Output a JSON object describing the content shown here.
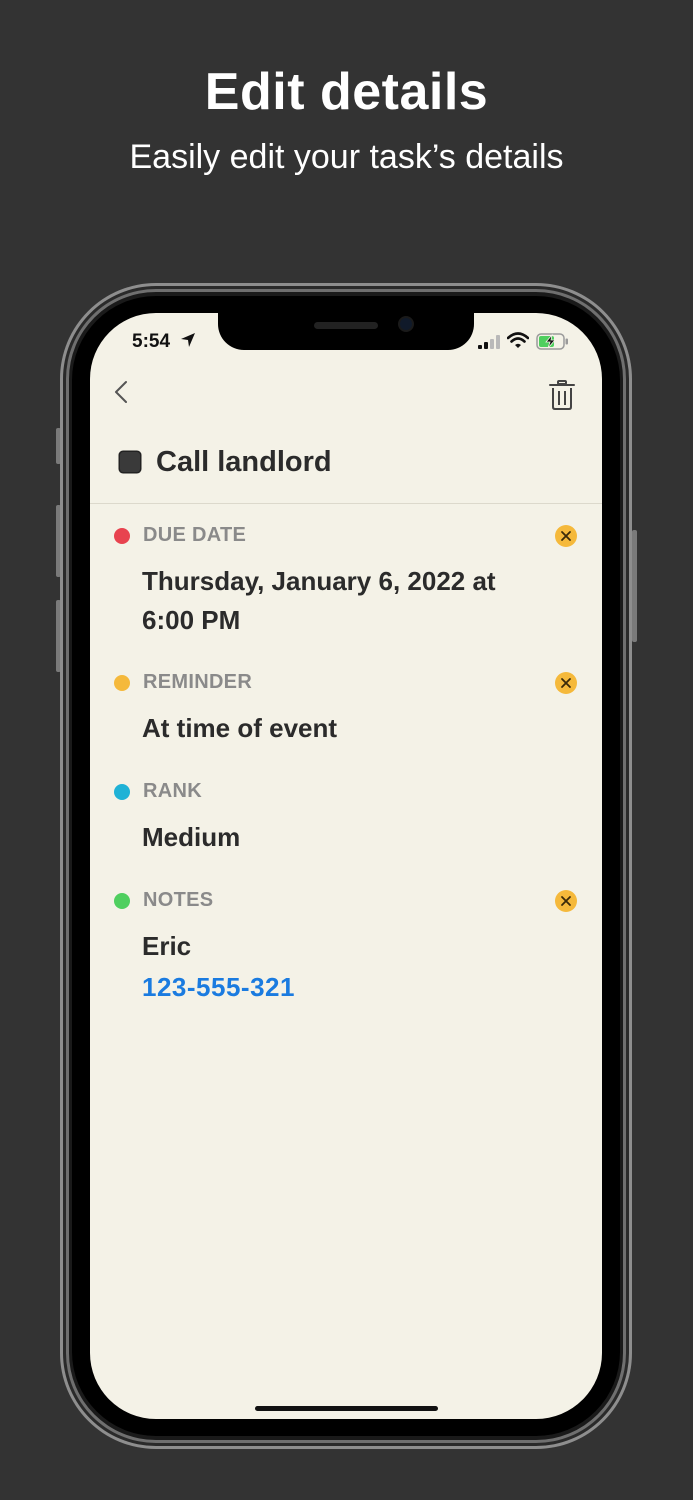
{
  "promo": {
    "headline": "Edit details",
    "subline": "Easily edit your task’s details"
  },
  "status_bar": {
    "time": "5:54",
    "icons": [
      "location-arrow-icon",
      "cellular-signal-icon",
      "wifi-icon",
      "battery-charging-icon"
    ]
  },
  "nav": {
    "back_icon": "chevron-left-icon",
    "delete_icon": "trash-icon"
  },
  "task": {
    "title": "Call landlord",
    "completed": false
  },
  "sections": {
    "due_date": {
      "label": "DUE DATE",
      "value_line1": "Thursday, January 6, 2022 at",
      "value_line2": "6:00 PM",
      "dot_color": "#e8434f"
    },
    "reminder": {
      "label": "REMINDER",
      "value": "At time of event",
      "dot_color": "#f5b93b"
    },
    "rank": {
      "label": "RANK",
      "value": "Medium",
      "dot_color": "#1fb2d6"
    },
    "notes": {
      "label": "NOTES",
      "value_line1": "Eric",
      "phone": "123-555-321",
      "dot_color": "#4fcf5f"
    }
  },
  "colors": {
    "background": "#333333",
    "screen": "#f4f2e7",
    "clear_button": "#f5b93b",
    "link": "#1a7be0"
  }
}
